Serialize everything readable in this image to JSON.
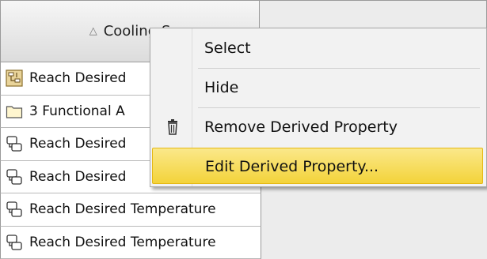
{
  "table": {
    "column_header": "Cooling S",
    "sort_indicator": "△",
    "rows": [
      {
        "icon": "function-element-icon",
        "text": "Reach Desired"
      },
      {
        "icon": "folder-icon",
        "text": "3 Functional A"
      },
      {
        "icon": "derived-property-icon",
        "text": "Reach Desired"
      },
      {
        "icon": "derived-property-icon",
        "text": "Reach Desired"
      },
      {
        "icon": "derived-property-icon",
        "text": "Reach Desired Temperature"
      },
      {
        "icon": "derived-property-icon",
        "text": "Reach Desired Temperature"
      }
    ]
  },
  "context_menu": {
    "items": [
      {
        "label": "Select",
        "icon": null
      },
      {
        "label": "Hide",
        "icon": null
      },
      {
        "label": "Remove Derived Property",
        "icon": "trash-icon"
      },
      {
        "label": "Edit Derived Property...",
        "icon": null,
        "highlighted": true
      }
    ]
  },
  "colors": {
    "highlight": "#f5d842",
    "menu_background": "#f2f2f2",
    "row_background": "#ffffff"
  }
}
